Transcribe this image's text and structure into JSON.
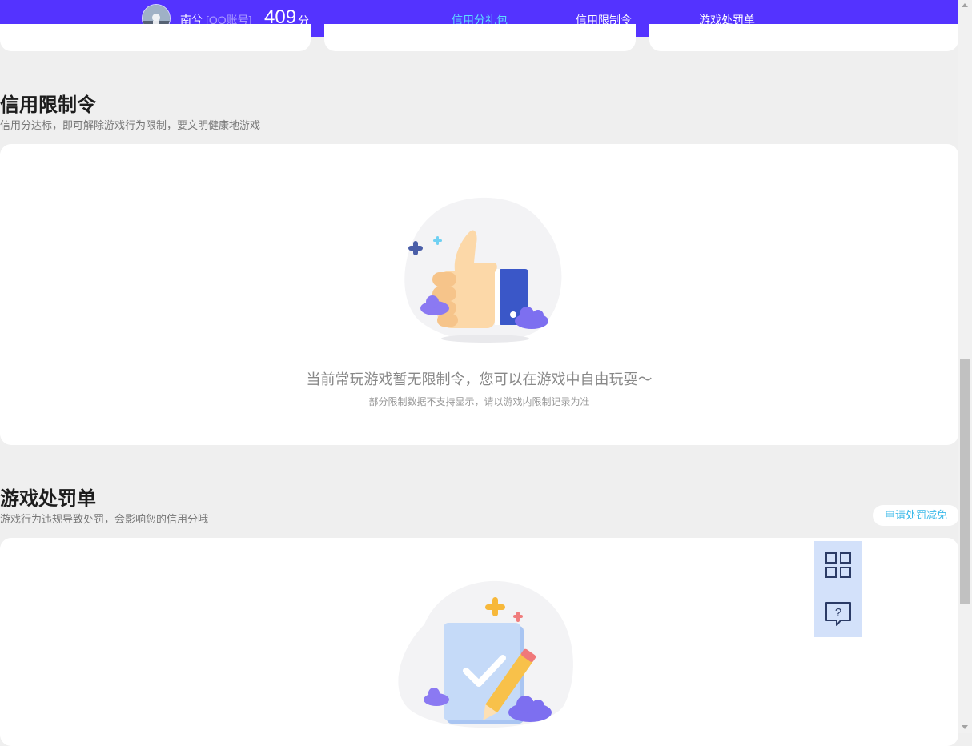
{
  "header": {
    "nickname": "南兮",
    "account_type": "[QQ账号]",
    "score": "409",
    "score_unit": "分",
    "tabs": [
      {
        "label": "信用分礼包",
        "active": true
      },
      {
        "label": "信用限制令",
        "active": false
      },
      {
        "label": "游戏处罚单",
        "active": false
      }
    ]
  },
  "restriction": {
    "title": "信用限制令",
    "subtitle": "信用分达标，即可解除游戏行为限制，要文明健康地游戏",
    "empty_text": "当前常玩游戏暂无限制令，您可以在游戏中自由玩耍～",
    "note": "部分限制数据不支持显示，请以游戏内限制记录为准"
  },
  "penalty": {
    "title": "游戏处罚单",
    "subtitle": "游戏行为违规导致处罚，会影响您的信用分哦",
    "appeal_button": "申请处罚减免"
  },
  "side_tools": [
    {
      "icon": "qr-code-icon"
    },
    {
      "icon": "help-chat-icon"
    }
  ],
  "colors": {
    "header_bg": "#5433ff",
    "active_tab": "#5de0ff",
    "page_bg": "#efefef",
    "side_tool_bg": "#d3e1fa",
    "appeal_text": "#3ab9e9"
  }
}
